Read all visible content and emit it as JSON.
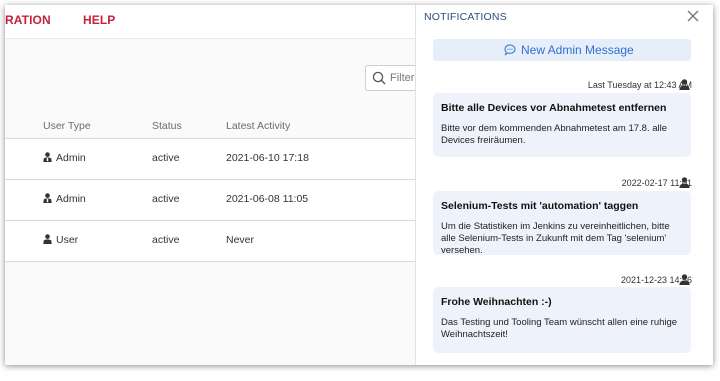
{
  "nav": {
    "items": [
      "RATION",
      "HELP"
    ]
  },
  "filter": {
    "placeholder": "Filter u"
  },
  "table": {
    "headers": [
      "User Type",
      "Status",
      "Latest Activity"
    ],
    "rows": [
      {
        "type": "Admin",
        "type_icon": "admin-user-icon",
        "status": "active",
        "activity": "2021-06-10 17:18"
      },
      {
        "type": "Admin",
        "type_icon": "admin-user-icon",
        "status": "active",
        "activity": "2021-06-08 11:05"
      },
      {
        "type": "User",
        "type_icon": "user-icon",
        "status": "active",
        "activity": "Never"
      }
    ]
  },
  "notifications": {
    "title": "NOTIFICATIONS",
    "close_icon": "close-icon",
    "new_message_label": "New Admin Message",
    "items": [
      {
        "timestamp": "Last Tuesday at 12:43 AM",
        "title": "Bitte alle Devices vor Abnahmetest entfernen",
        "body": "Bitte vor dem kommenden Abnahmetest am 17.8. alle Devices freiräumen."
      },
      {
        "timestamp": "2022-02-17 11:01",
        "title": "Selenium-Tests mit 'automation' taggen",
        "body": "Um die Statistiken im Jenkins zu vereinheitlichen, bitte alle Selenium-Tests in Zukunft mit dem Tag 'selenium' versehen."
      },
      {
        "timestamp": "2021-12-23 14:56",
        "title": "Frohe Weihnachten :-)",
        "body": "Das Testing und Tooling Team wünscht allen eine ruhige Weihnachtszeit!"
      }
    ]
  },
  "colors": {
    "accent_red": "#c4213c",
    "title_blue": "#2a4d7c",
    "link_blue": "#2f6fcf",
    "card_bg": "#eef2fb"
  }
}
